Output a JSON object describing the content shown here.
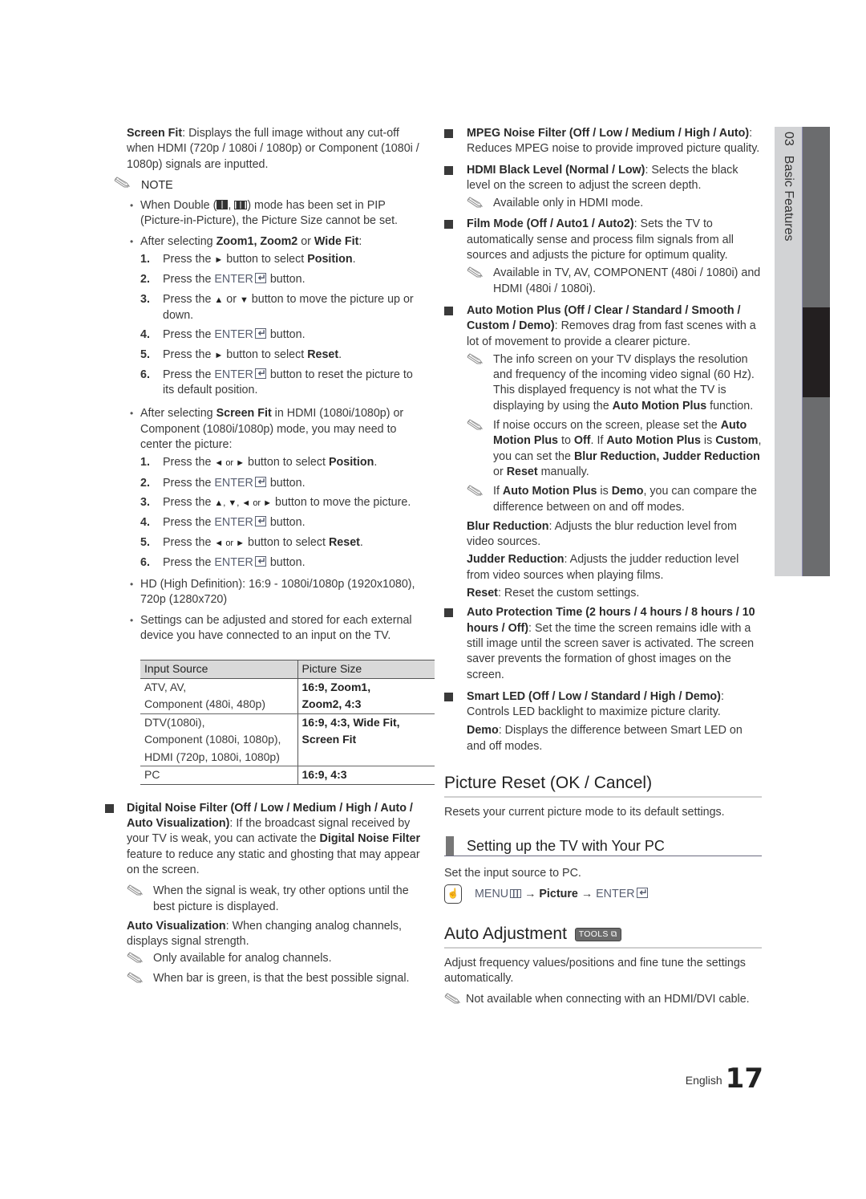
{
  "side_tab": {
    "chapter": "03",
    "title": "Basic Features"
  },
  "left": {
    "screen_fit": {
      "term": "Screen Fit",
      "text": ": Displays the full image without any cut-off when HDMI (720p / 1080i / 1080p) or Component (1080i / 1080p) signals are inputted."
    },
    "note_label": "NOTE",
    "note1": {
      "pre": "When Double (",
      "mid": ", ",
      "post": ") mode has been set in PIP (Picture-in-Picture), the Picture Size cannot be set."
    },
    "note2": {
      "pre": "After selecting ",
      "term": "Zoom1, Zoom2",
      "or": " or ",
      "term2": "Wide Fit",
      "post": ":",
      "steps": [
        {
          "num": "1.",
          "pre": "Press the ",
          "icon": "►",
          "post": " button to select ",
          "term": "Position",
          "end": "."
        },
        {
          "num": "2.",
          "pre": "Press the ",
          "enter": "ENTER",
          "post": " button."
        },
        {
          "num": "3.",
          "pre": "Press the ",
          "icon": "▲",
          "mid": " or ",
          "icon2": "▼",
          "post": " button to move the picture up or down."
        },
        {
          "num": "4.",
          "pre": "Press the ",
          "enter": "ENTER",
          "post": " button."
        },
        {
          "num": "5.",
          "pre": "Press the ",
          "icon": "►",
          "post": " button to select ",
          "term": "Reset",
          "end": "."
        },
        {
          "num": "6.",
          "pre": "Press the ",
          "enter": "ENTER",
          "post": " button to reset the picture to its default position."
        }
      ]
    },
    "note3": {
      "pre": "After selecting ",
      "term": "Screen Fit",
      "post": " in HDMI (1080i/1080p) or Component (1080i/1080p) mode, you may need to center the picture:",
      "steps": [
        {
          "num": "1.",
          "pre": "Press the ",
          "icons": "◄ or ►",
          "post": " button to select ",
          "term": "Position",
          "end": "."
        },
        {
          "num": "2.",
          "pre": "Press the ",
          "enter": "ENTER",
          "post": " button."
        },
        {
          "num": "3.",
          "pre": "Press the ",
          "icons": "▲, ▼, ◄ or ►",
          "post": " button to move the picture."
        },
        {
          "num": "4.",
          "pre": "Press the ",
          "enter": "ENTER",
          "post": " button."
        },
        {
          "num": "5.",
          "pre": "Press the ",
          "icons": "◄ or ►",
          "post": " button to select ",
          "term": "Reset",
          "end": "."
        },
        {
          "num": "6.",
          "pre": "Press the ",
          "enter": "ENTER",
          "post": " button."
        }
      ]
    },
    "note4": "HD (High Definition): 16:9 - 1080i/1080p (1920x1080), 720p (1280x720)",
    "note5": "Settings can be adjusted and stored for each external device you have connected to an input on the TV.",
    "table": {
      "headers": [
        "Input Source",
        "Picture Size"
      ],
      "rows": [
        {
          "source": [
            "ATV, AV,",
            "Component (480i, 480p)"
          ],
          "size": [
            "16:9, Zoom1,",
            "Zoom2, 4:3"
          ]
        },
        {
          "source": [
            "DTV(1080i),",
            "Component (1080i, 1080p),",
            "HDMI (720p, 1080i, 1080p)"
          ],
          "size": [
            "16:9, 4:3, Wide Fit,",
            "Screen Fit"
          ]
        },
        {
          "source": [
            "PC"
          ],
          "size": [
            "16:9, 4:3"
          ]
        }
      ]
    },
    "dnf": {
      "term_a": "Digital Noise Filter (Off / Low / Medium / High / Auto / Auto Visualization)",
      "text_a": ": If the broadcast signal received by your TV is weak, you can activate the ",
      "term_b": "Digital Noise Filter",
      "text_b": " feature to reduce any static and ghosting that may appear on the screen.",
      "note": "When the signal is weak, try other options until the best picture is displayed."
    },
    "auto_vis": {
      "term": "Auto Visualization",
      "text": ": When changing analog channels, displays signal strength.",
      "notes": [
        "Only available for analog channels.",
        "When bar is green, is that the best possible signal."
      ]
    }
  },
  "right": {
    "mpeg": {
      "term": "MPEG Noise Filter (Off / Low / Medium / High / Auto)",
      "text": ": Reduces MPEG noise to provide improved picture quality."
    },
    "hdmi_black": {
      "term": "HDMI Black Level (Normal / Low)",
      "text": ": Selects the black level on the screen to adjust the screen depth.",
      "note": "Available only in HDMI mode."
    },
    "film_mode": {
      "term": "Film Mode (Off / Auto1 / Auto2)",
      "text": ": Sets the TV to automatically sense and process film signals from all sources and adjusts the picture for optimum quality.",
      "note": "Available in TV, AV, COMPONENT (480i / 1080i) and HDMI (480i / 1080i)."
    },
    "amp": {
      "term": "Auto Motion Plus (Off / Clear / Standard / Smooth / Custom / Demo)",
      "text": ": Removes drag from fast scenes with a lot of movement to provide a clearer picture.",
      "note1": {
        "pre": "The info screen on your TV displays the resolution and frequency of the incoming video signal (60 Hz). This displayed frequency is not what the TV is displaying by using the ",
        "term": "Auto Motion Plus",
        "post": " function."
      },
      "note2": {
        "a": "If noise occurs on the screen, please set the ",
        "t1": "Auto Motion Plus",
        "b": " to ",
        "t2": "Off",
        "c": ". If ",
        "t3": "Auto Motion Plus",
        "d": " is ",
        "t4": "Custom",
        "e": ", you can set the ",
        "t5": "Blur Reduction, Judder Reduction",
        "f": " or ",
        "t6": "Reset",
        "g": " manually."
      },
      "note3": {
        "a": "If ",
        "t1": "Auto Motion Plus",
        "b": " is ",
        "t2": "Demo",
        "c": ", you can compare the difference between on and off modes."
      },
      "blur": {
        "term": "Blur Reduction",
        "text": ": Adjusts the blur reduction level from video sources."
      },
      "judder": {
        "term": "Judder Reduction",
        "text": ": Adjusts the judder reduction level from video sources when playing films."
      },
      "reset": {
        "term": "Reset",
        "text": ": Reset the custom settings."
      }
    },
    "apt": {
      "term": "Auto Protection Time (2 hours / 4 hours / 8 hours / 10 hours / Off)",
      "text": ": Set the time the screen remains idle with a still image until the screen saver is activated. The screen saver prevents the formation of ghost images on the screen."
    },
    "smart_led": {
      "term": "Smart LED (Off / Low / Standard / High / Demo)",
      "text": ": Controls LED backlight to maximize picture clarity.",
      "demo_term": "Demo",
      "demo_text": ": Displays the difference between Smart LED on and off modes."
    },
    "picture_reset": {
      "title": "Picture Reset (OK / Cancel)",
      "text": "Resets your current picture mode to its default settings."
    },
    "pc_setup": {
      "title": "Setting up the TV with Your PC",
      "text": "Set the input source to PC.",
      "menu": {
        "menu": "MENU",
        "arrow1": "→",
        "picture": "Picture",
        "arrow2": "→",
        "enter": "ENTER"
      }
    },
    "auto_adjust": {
      "title": "Auto Adjustment",
      "badge": "TOOLS",
      "text": "Adjust frequency values/positions and fine tune the settings automatically.",
      "note": "Not available when connecting with an HDMI/DVI cable."
    }
  },
  "footer": {
    "language": "English",
    "page": "17"
  }
}
